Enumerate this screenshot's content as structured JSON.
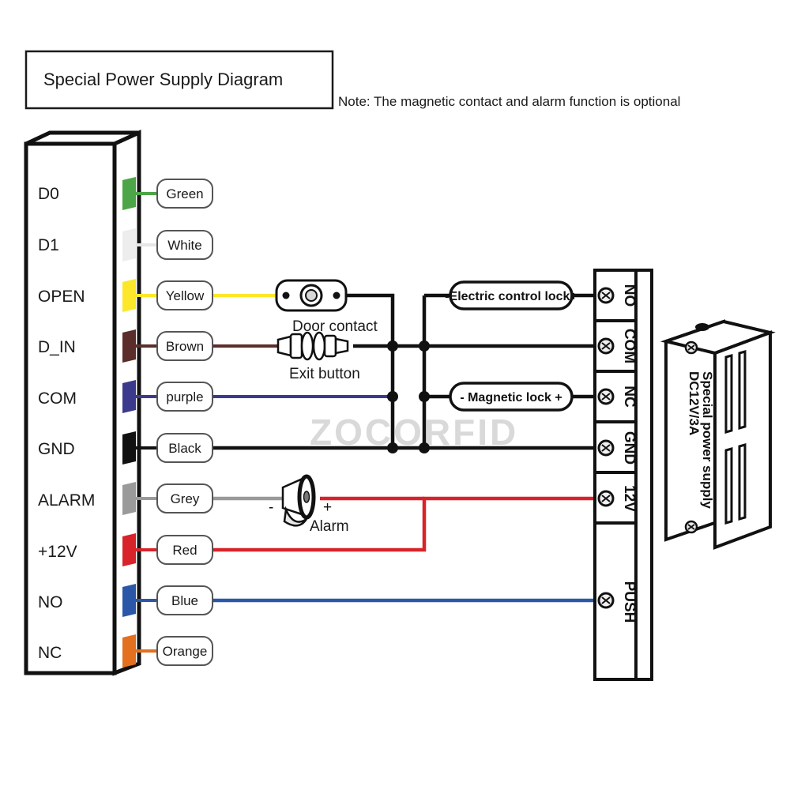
{
  "header": {
    "title": "Special Power Supply Diagram",
    "note": "Note: The magnetic contact and alarm function is optional"
  },
  "watermark": {
    "text": "ZOCORFID"
  },
  "controller": {
    "name": "access-controller-connector",
    "terminals": [
      {
        "label": "D0",
        "wire": "Green",
        "color": "#4CA546"
      },
      {
        "label": "D1",
        "wire": "White",
        "color": "#ededed"
      },
      {
        "label": "OPEN",
        "wire": "Yellow",
        "color": "#fde72a"
      },
      {
        "label": "D_IN",
        "wire": "Brown",
        "color": "#5b2d2b"
      },
      {
        "label": "COM",
        "wire": "purple",
        "color": "#3c3a8c"
      },
      {
        "label": "GND",
        "wire": "Black",
        "color": "#111111"
      },
      {
        "label": "ALARM",
        "wire": "Grey",
        "color": "#9a9a9a"
      },
      {
        "label": "+12V",
        "wire": "Red",
        "color": "#d8232a"
      },
      {
        "label": "NO",
        "wire": "Blue",
        "color": "#2b57a8"
      },
      {
        "label": "NC",
        "wire": "Orange",
        "color": "#e2701e"
      }
    ]
  },
  "devices": {
    "door_contact": {
      "caption": "Door contact"
    },
    "exit_button": {
      "caption": "Exit button"
    },
    "alarm": {
      "caption": "Alarm",
      "minus": "-",
      "plus": "+"
    },
    "electric_lock": {
      "label": "-Electric control lock+"
    },
    "magnetic_lock": {
      "label": "- Magnetic lock +"
    }
  },
  "power_terminal": {
    "name": "power-supply-terminal-block",
    "terminals": [
      "NO",
      "COM",
      "NC",
      "GND",
      "12V",
      "PUSH"
    ]
  },
  "power_supply": {
    "line1": "DC12V/3A",
    "line2": "Special power supply"
  }
}
